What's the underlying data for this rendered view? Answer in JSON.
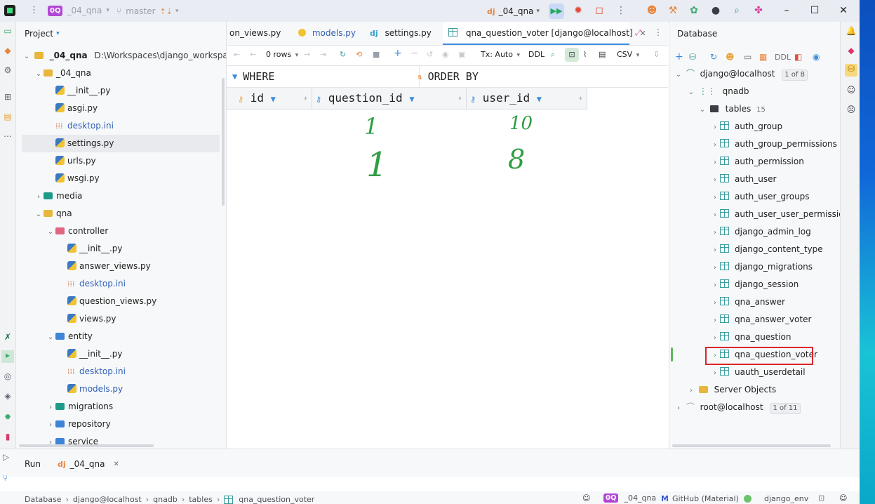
{
  "titlebar": {
    "project_badge": "0Q",
    "project_name": "_04_qna",
    "branch": "master",
    "run_config": "_04_qna"
  },
  "project_panel": {
    "title": "Project",
    "root_name": "_04_qna",
    "root_path": "D:\\Workspaces\\django_workspace\\K",
    "items": [
      {
        "label": "_04_qna",
        "kind": "folder",
        "depth": 1,
        "expanded": true
      },
      {
        "label": "__init__.py",
        "kind": "py",
        "depth": 2
      },
      {
        "label": "asgi.py",
        "kind": "py",
        "depth": 2
      },
      {
        "label": "desktop.ini",
        "kind": "ini",
        "depth": 2
      },
      {
        "label": "settings.py",
        "kind": "py",
        "depth": 2,
        "selected": true
      },
      {
        "label": "urls.py",
        "kind": "py",
        "depth": 2
      },
      {
        "label": "wsgi.py",
        "kind": "py",
        "depth": 2
      },
      {
        "label": "media",
        "kind": "folder-teal",
        "depth": 1,
        "expanded": false
      },
      {
        "label": "qna",
        "kind": "folder",
        "depth": 1,
        "expanded": true
      },
      {
        "label": "controller",
        "kind": "folder-pink",
        "depth": 2,
        "expanded": true
      },
      {
        "label": "__init__.py",
        "kind": "py",
        "depth": 3
      },
      {
        "label": "answer_views.py",
        "kind": "py",
        "depth": 3
      },
      {
        "label": "desktop.ini",
        "kind": "ini",
        "depth": 3
      },
      {
        "label": "question_views.py",
        "kind": "py",
        "depth": 3
      },
      {
        "label": "views.py",
        "kind": "py",
        "depth": 3
      },
      {
        "label": "entity",
        "kind": "folder-blue",
        "depth": 2,
        "expanded": true
      },
      {
        "label": "__init__.py",
        "kind": "py",
        "depth": 3
      },
      {
        "label": "desktop.ini",
        "kind": "ini",
        "depth": 3
      },
      {
        "label": "models.py",
        "kind": "py",
        "depth": 3
      },
      {
        "label": "migrations",
        "kind": "folder-teal",
        "depth": 2,
        "expanded": false
      },
      {
        "label": "repository",
        "kind": "folder-blue",
        "depth": 2,
        "expanded": false
      },
      {
        "label": "service",
        "kind": "folder-blue",
        "depth": 2,
        "expanded": false
      }
    ]
  },
  "editor": {
    "tabs": [
      {
        "label": "on_views.py",
        "icon": "python-icon"
      },
      {
        "label": "models.py",
        "icon": "python-icon"
      },
      {
        "label": "settings.py",
        "icon": "django-icon"
      },
      {
        "label": "qna_question_voter [django@localhost]",
        "icon": "table-icon",
        "active": true
      }
    ],
    "toolbar": {
      "rows": "0 rows",
      "tx": "Tx: Auto",
      "ddl": "DDL",
      "csv": "CSV"
    },
    "where_label": "WHERE",
    "orderby_label": "ORDER BY",
    "columns": [
      "id",
      "question_id",
      "user_id"
    ],
    "annotations": {
      "col1_top": "1",
      "col1_bottom": "1",
      "col2_top": "10",
      "col2_bottom": "8"
    }
  },
  "database_panel": {
    "title": "Database",
    "toolbar_ddl": "DDL",
    "connection": "django@localhost",
    "connection_badge": "1 of 8",
    "schema": "qnadb",
    "tables_label": "tables",
    "tables_count": "15",
    "tables": [
      "auth_group",
      "auth_group_permissions",
      "auth_permission",
      "auth_user",
      "auth_user_groups",
      "auth_user_user_permissions",
      "django_admin_log",
      "django_content_type",
      "django_migrations",
      "django_session",
      "qna_answer",
      "qna_answer_voter",
      "qna_question",
      "qna_question_voter",
      "uauth_userdetail"
    ],
    "highlighted_table": "qna_question_voter",
    "server_objects": "Server Objects",
    "root_connection": "root@localhost",
    "root_badge": "1 of 11"
  },
  "run_panel": {
    "run_label": "Run",
    "run_tab": "_04_qna"
  },
  "statusbar": {
    "crumbs": [
      "Database",
      "django@localhost",
      "qnadb",
      "tables",
      "qna_question_voter"
    ],
    "project_badge": "0Q",
    "project": "_04_qna",
    "theme": "GitHub (Material)",
    "env": "django_env"
  },
  "colors": {
    "highlight_border": "#d9262a",
    "annotation_ink": "#2f9e44",
    "accent": "#3b8be0"
  }
}
